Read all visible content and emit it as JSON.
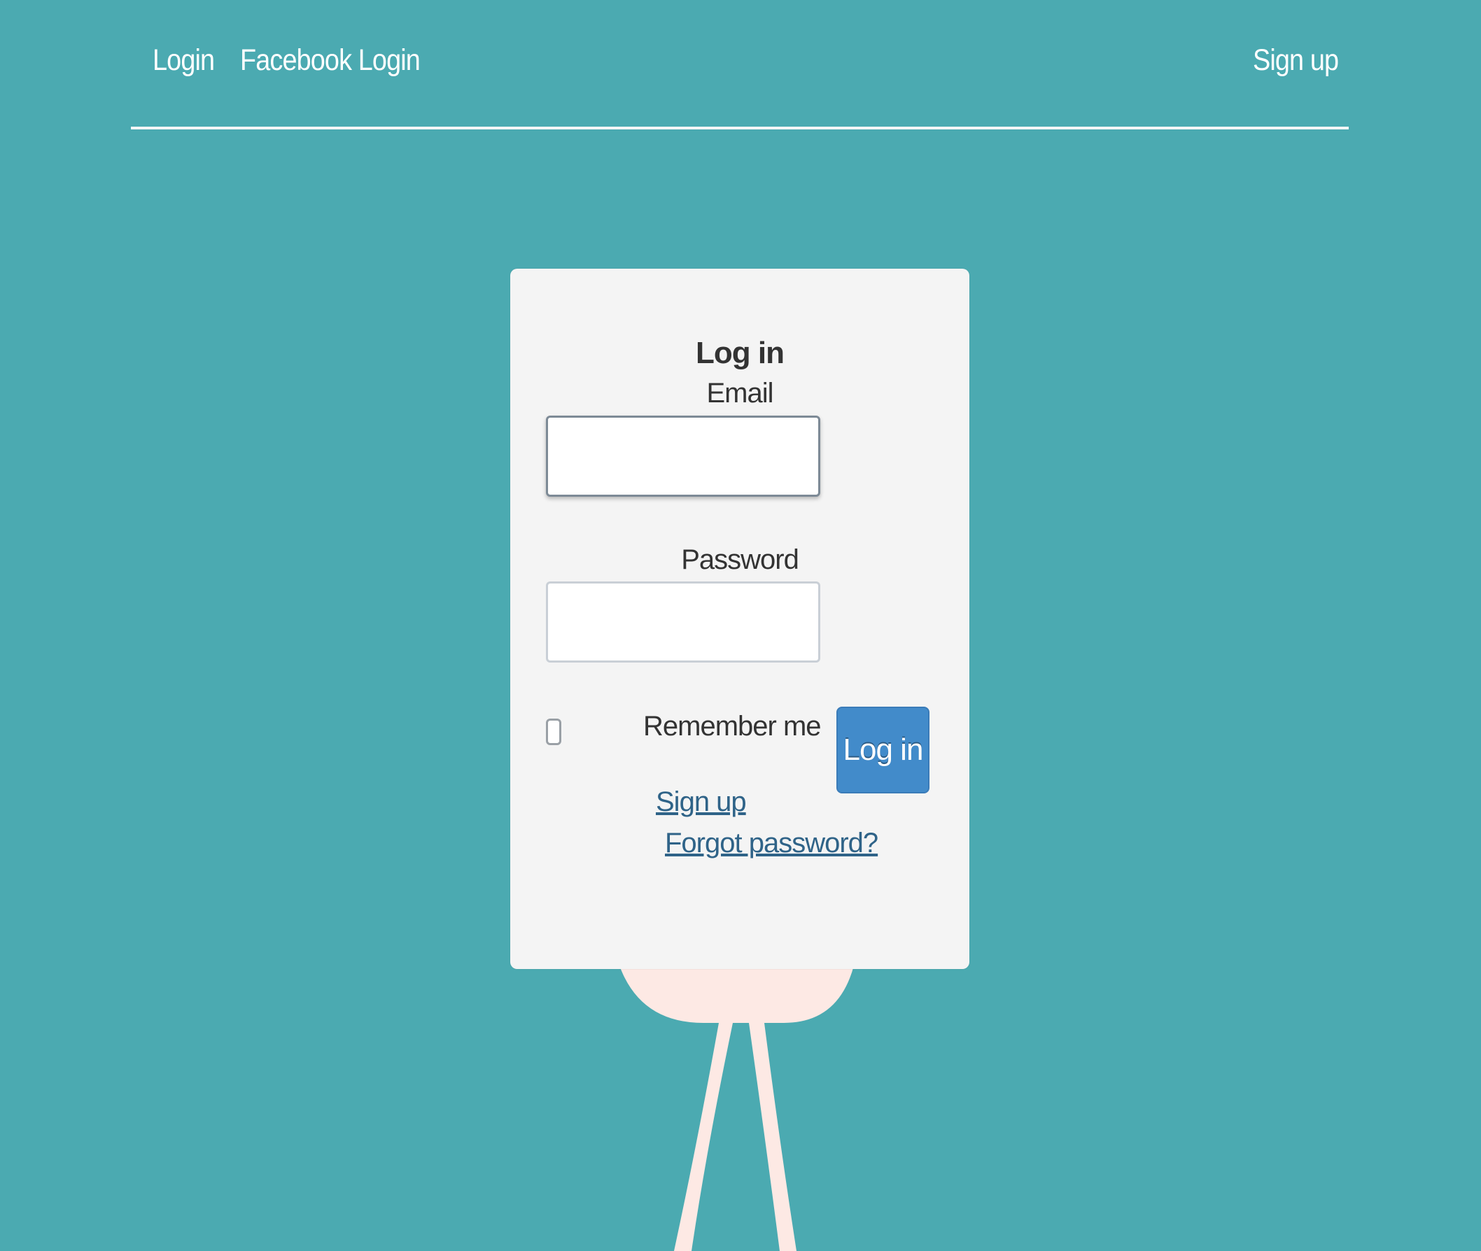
{
  "colors": {
    "background": "#4BAAB1",
    "card": "#F4F4F4",
    "primary_button": "#428BCA",
    "link": "#2F6388",
    "figure": "#FDE9E4"
  },
  "nav": {
    "login": "Login",
    "facebook_login": "Facebook Login",
    "sign_up": "Sign up"
  },
  "form": {
    "title": "Log in",
    "email_label": "Email",
    "email_value": "",
    "password_label": "Password",
    "password_value": "",
    "remember_label": "Remember me",
    "remember_checked": false,
    "submit_label": "Log in",
    "signup_link": "Sign up",
    "forgot_link": "Forgot password?"
  }
}
